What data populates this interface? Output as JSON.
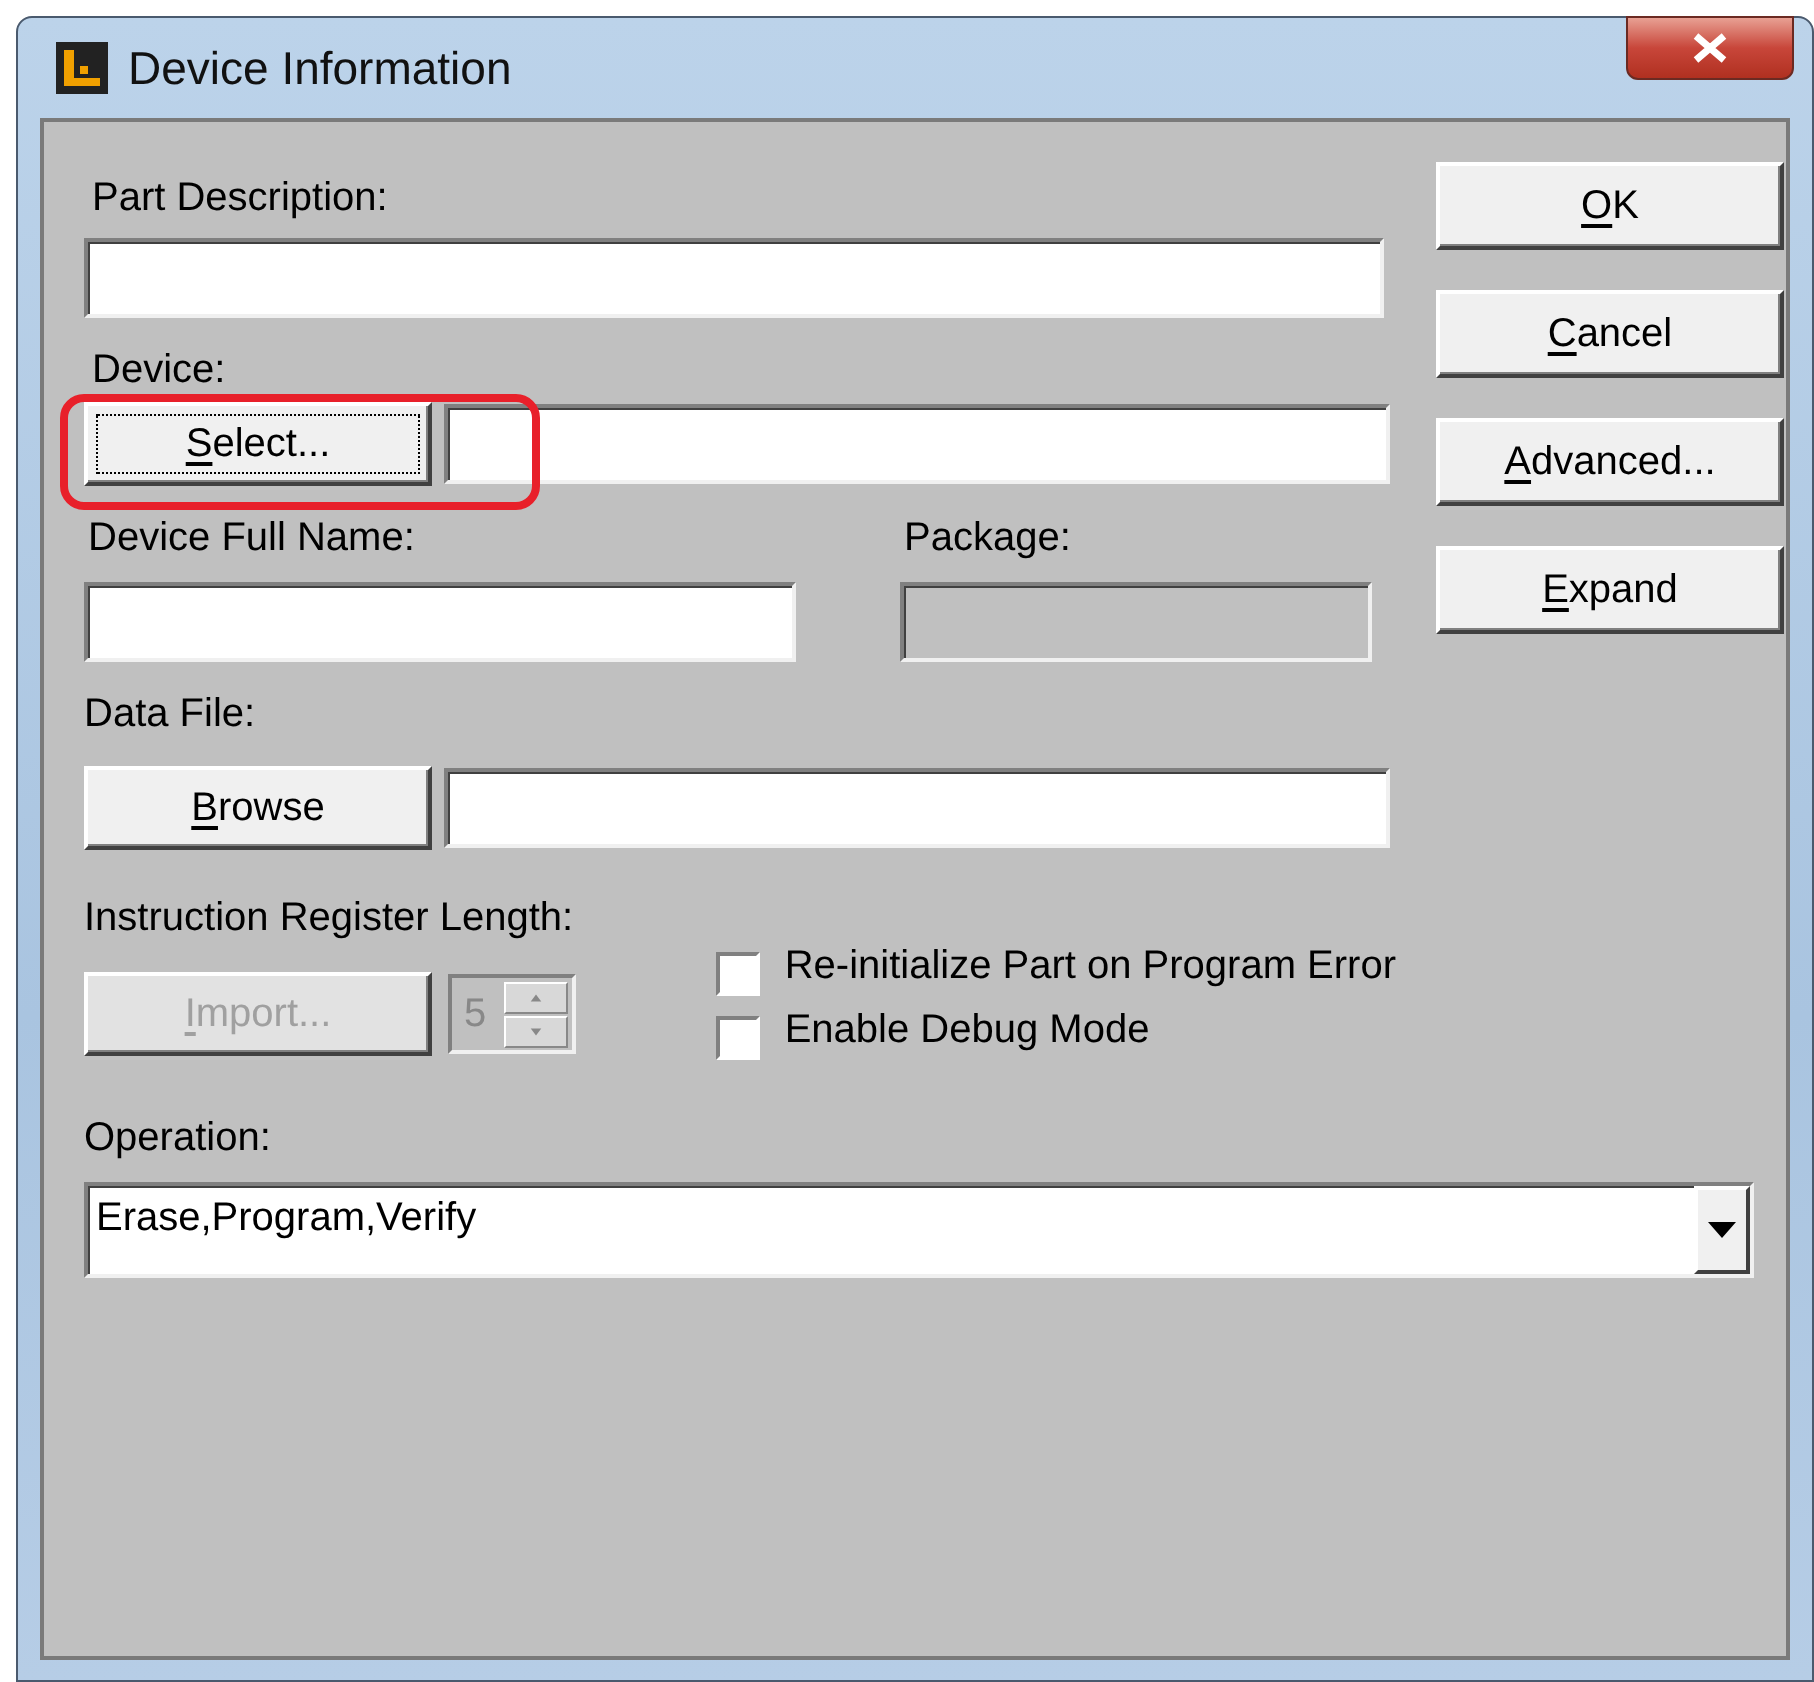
{
  "window": {
    "title": "Device Information"
  },
  "part_description": {
    "label": "Part Description:"
  },
  "device": {
    "label": "Device:",
    "button": {
      "label": "Select...",
      "focused": true
    }
  },
  "device_full_name": {
    "label": "Device Full Name:"
  },
  "package": {
    "label": "Package:",
    "disabled": true
  },
  "data_file": {
    "label": "Data File:",
    "button": {
      "label": "Browse",
      "focused": false
    }
  },
  "instruction_register": {
    "label": "Instruction Register Length:",
    "button": {
      "label": "Import...",
      "disabled": true
    },
    "spinner": {
      "value": "5",
      "disabled": true
    }
  },
  "options": [
    {
      "label": "Re-initialize Part on Program Error",
      "checked": false
    },
    {
      "label": "Enable Debug Mode",
      "checked": false
    }
  ],
  "operation": {
    "label": "Operation:",
    "value": "Erase,Program,Verify"
  },
  "buttons": [
    {
      "label": "OK"
    },
    {
      "label": "Cancel"
    },
    {
      "label": "Advanced..."
    },
    {
      "label": "Expand"
    }
  ]
}
